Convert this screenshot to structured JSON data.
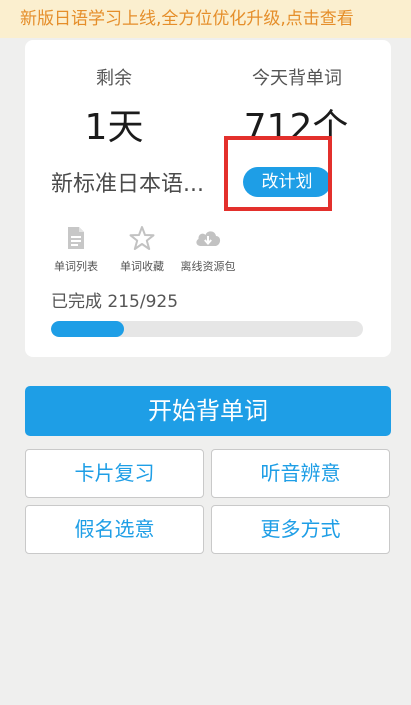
{
  "banner": {
    "text": "新版日语学习上线,全方位优化升级,点击查看"
  },
  "stats": {
    "remaining_label": "剩余",
    "remaining_value": "1天",
    "today_label": "今天背单词",
    "today_value": "712个"
  },
  "book": {
    "title": "新标准日本语...",
    "plan_button": "改计划"
  },
  "tools": [
    {
      "label": "单词列表",
      "icon": "document-icon"
    },
    {
      "label": "单词收藏",
      "icon": "star-icon"
    },
    {
      "label": "离线资源包",
      "icon": "cloud-download-icon"
    }
  ],
  "progress": {
    "text": "已完成 215/925",
    "completed": 215,
    "total": 925
  },
  "actions": {
    "start": "开始背单词",
    "card_review": "卡片复习",
    "listen_meaning": "听音辨意",
    "kana_select": "假名选意",
    "more_modes": "更多方式"
  },
  "colors": {
    "accent": "#1e9ee6",
    "banner_bg": "#fbefcf",
    "banner_text": "#e58e2a",
    "highlight": "#e3302c"
  }
}
